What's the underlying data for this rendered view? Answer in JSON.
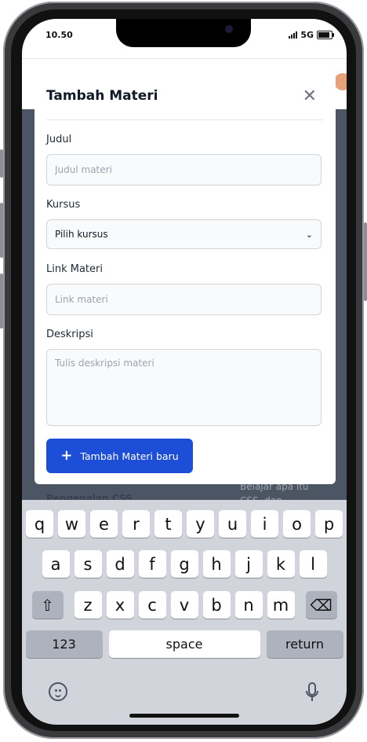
{
  "status_bar": {
    "time": "10.50",
    "network": "5G"
  },
  "background": {
    "text_left": "Pengenalan CSS",
    "text_right": "Belajar apa itu CSS, dan"
  },
  "modal": {
    "title": "Tambah Materi",
    "fields": {
      "judul": {
        "label": "Judul",
        "placeholder": "Judul materi"
      },
      "kursus": {
        "label": "Kursus",
        "value": "Pilih kursus"
      },
      "link": {
        "label": "Link Materi",
        "placeholder": "Link materi"
      },
      "deskripsi": {
        "label": "Deskripsi",
        "placeholder": "Tulis deskripsi materi"
      }
    },
    "submit_label": "Tambah Materi baru"
  },
  "keyboard": {
    "row1": [
      "q",
      "w",
      "e",
      "r",
      "t",
      "y",
      "u",
      "i",
      "o",
      "p"
    ],
    "row2": [
      "a",
      "s",
      "d",
      "f",
      "g",
      "h",
      "j",
      "k",
      "l"
    ],
    "row3": [
      "z",
      "x",
      "c",
      "v",
      "b",
      "n",
      "m"
    ],
    "numbers_label": "123",
    "space_label": "space",
    "return_label": "return"
  },
  "colors": {
    "accent": "#1d4ed8",
    "overlay": "#4b5563"
  }
}
